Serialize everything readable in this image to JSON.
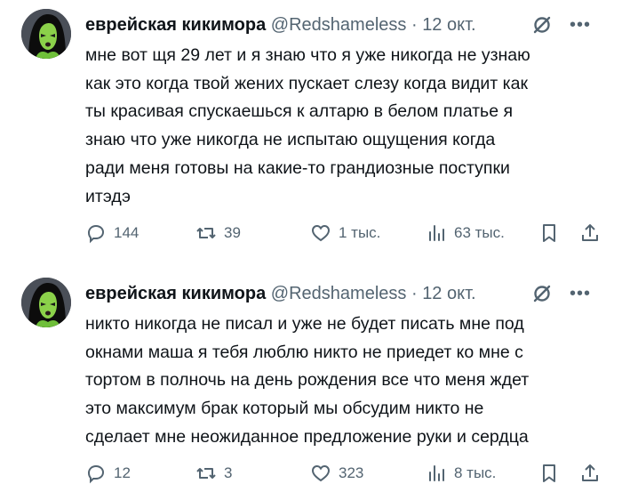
{
  "tweets": [
    {
      "author_name": "еврейская кикимора",
      "handle": "@Redshameless",
      "separator": "·",
      "date": "12 окт.",
      "text": "мне вот щя 29 лет и я знаю что я уже никогда не узнаю\nкак это когда твой жених пускает слезу когда видит как\nты красивая спускаешься к алтарю в белом платье я\nзнаю что уже никогда не испытаю ощущения когда\nради меня готовы на какие-то грандиозные поступки\nитэдэ",
      "replies": "144",
      "retweets": "39",
      "likes": "1 тыс.",
      "views": "63 тыс."
    },
    {
      "author_name": "еврейская кикимора",
      "handle": "@Redshameless",
      "separator": "·",
      "date": "12 окт.",
      "text": "никто никогда не писал и уже не будет писать мне под\nокнами маша я тебя люблю никто не приедет ко мне с\nтортом в полночь на день рождения все что меня ждет\nэто максимум брак который мы обсудим никто не\nсделает мне неожиданное предложение руки и сердца",
      "replies": "12",
      "retweets": "3",
      "likes": "323",
      "views": "8 тыс."
    }
  ],
  "icons": {
    "more": "more-icon",
    "grok": "grok-icon",
    "reply": "reply-icon",
    "retweet": "retweet-icon",
    "like": "heart-icon",
    "views": "views-icon",
    "bookmark": "bookmark-icon",
    "share": "share-icon"
  },
  "colors": {
    "text": "#0f1419",
    "secondary": "#536471",
    "background": "#ffffff"
  }
}
